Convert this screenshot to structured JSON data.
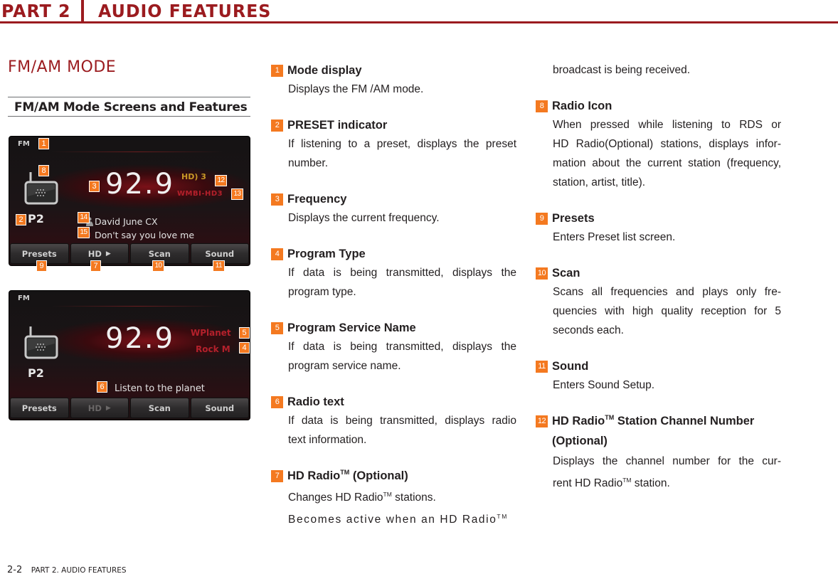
{
  "header": {
    "part": "PART 2",
    "title": "AUDIO FEATURES"
  },
  "section": {
    "title": "FM/AM MODE",
    "subtitle": "FM/AM Mode Screens and Features"
  },
  "screen1": {
    "mode": "FM",
    "preset": "P2",
    "frequency": "92.9",
    "hd_channel": "HD) 3",
    "call_sign": "WMBI-HD3",
    "artist": "David June CX",
    "song": "Don't say you love me",
    "buttons": [
      {
        "label": "Presets",
        "enabled": true
      },
      {
        "label": "HD",
        "enabled": true,
        "icon": "play-arrow-icon"
      },
      {
        "label": "Scan",
        "enabled": true
      },
      {
        "label": "Sound",
        "enabled": true
      }
    ],
    "callouts": [
      "1",
      "8",
      "3",
      "12",
      "13",
      "2",
      "14",
      "15",
      "9",
      "7",
      "10",
      "11"
    ]
  },
  "screen2": {
    "mode": "FM",
    "preset": "P2",
    "frequency": "92.9",
    "program_service_name": "WPlanet",
    "program_type": "Rock M",
    "radio_text": "Listen to the planet",
    "buttons": [
      {
        "label": "Presets",
        "enabled": true
      },
      {
        "label": "HD",
        "enabled": false,
        "icon": "play-arrow-icon"
      },
      {
        "label": "Scan",
        "enabled": true
      },
      {
        "label": "Sound",
        "enabled": true
      }
    ],
    "callouts": [
      "5",
      "4",
      "6"
    ]
  },
  "items": [
    {
      "num": "1",
      "title": "Mode display",
      "desc": [
        "Displays the FM /AM mode."
      ]
    },
    {
      "num": "2",
      "title": "PRESET indicator",
      "desc": [
        "If listening to a preset, displays the preset",
        "number."
      ]
    },
    {
      "num": "3",
      "title": "Frequency",
      "desc": [
        "Displays the current frequency."
      ]
    },
    {
      "num": "4",
      "title": "Program Type",
      "desc": [
        "If data is being transmitted, displays the",
        "program type."
      ]
    },
    {
      "num": "5",
      "title": "Program Service Name",
      "desc": [
        "If data is being transmitted, displays the",
        "program service name."
      ]
    },
    {
      "num": "6",
      "title": "Radio text",
      "desc": [
        "If data is being transmitted, displays radio",
        "text information."
      ]
    },
    {
      "num": "7",
      "title": "HD Radio",
      "title_sup": "TM",
      "title_suffix": " (Optional)",
      "desc_a": "Changes HD Radio",
      "desc_a_sup": "TM",
      "desc_a_end": " stations.",
      "desc_b": "Becomes active when an HD Radio",
      "desc_b_sup": "TM",
      "desc_c": "broadcast is being received."
    },
    {
      "num": "8",
      "title": "Radio Icon",
      "desc": [
        "When pressed while listening to RDS or",
        "HD Radio(Optional) stations, displays infor-",
        "mation about the current station (frequency,",
        "station, artist, title)."
      ]
    },
    {
      "num": "9",
      "title": "Presets",
      "desc": [
        "Enters Preset list screen."
      ]
    },
    {
      "num": "10",
      "title": "Scan",
      "desc": [
        "Scans all frequencies and plays only fre-",
        "quencies with high quality reception for 5",
        "seconds each."
      ]
    },
    {
      "num": "11",
      "title": "Sound",
      "desc": [
        "Enters Sound Setup."
      ]
    },
    {
      "num": "12",
      "title": "HD Radio",
      "title_sup": "TM",
      "title_suffix": " Station Channel Number",
      "title_line2": "(Optional)",
      "desc_a": "Displays the channel number for the cur-",
      "desc_b": "rent HD Radio",
      "desc_b_sup": "TM",
      "desc_b_end": " station."
    }
  ],
  "footer": {
    "page": "2-2",
    "label": "PART 2. AUDIO FEATURES"
  },
  "colors": {
    "brand_red": "#9b1b1f",
    "callout_orange": "#f47920",
    "screen_accent_red": "#b4202b",
    "hd_gold": "#c89a26"
  }
}
